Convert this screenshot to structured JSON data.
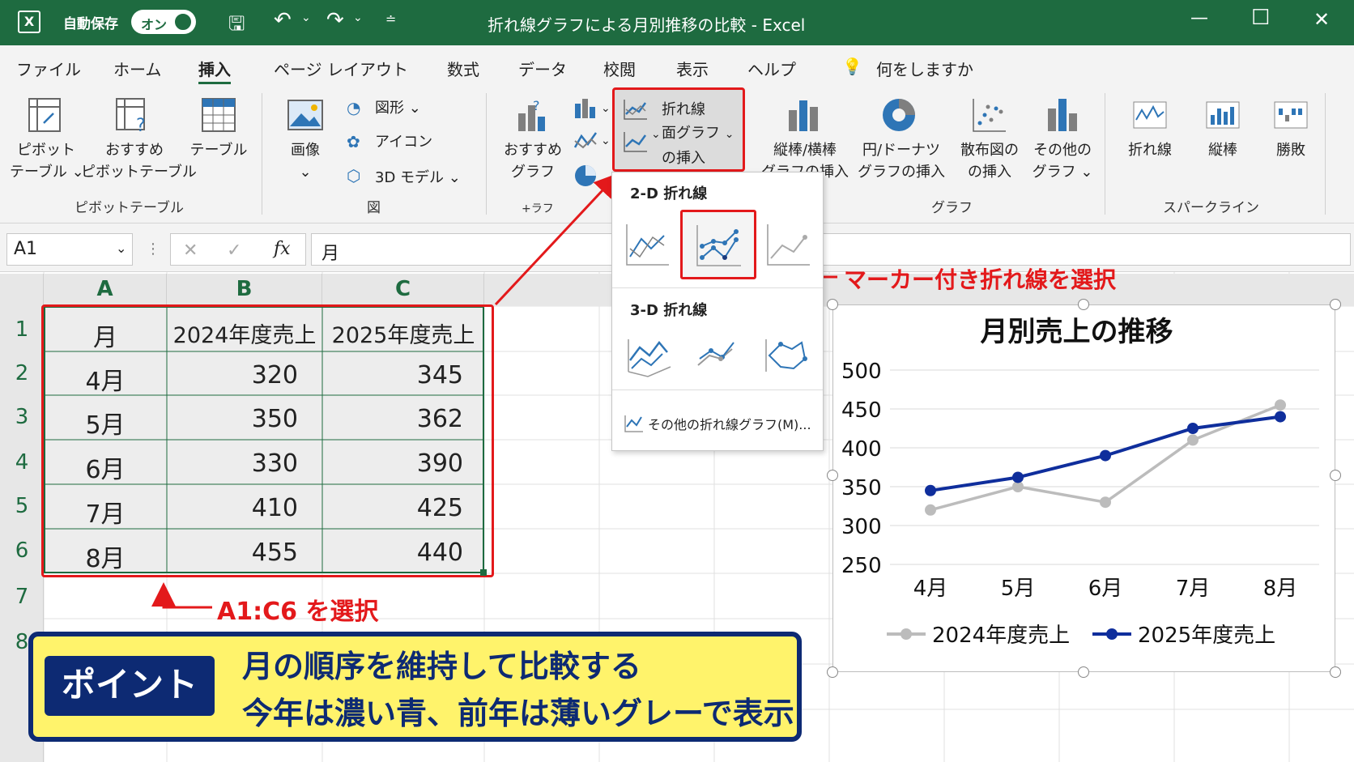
{
  "titlebar": {
    "autosave_label": "自動保存",
    "autosave_state": "オン",
    "window_title": "折れ線グラフによる月別推移の比較 - Excel"
  },
  "menu": {
    "tabs": [
      "ファイル",
      "ホーム",
      "挿入",
      "ページ レイアウト",
      "数式",
      "データ",
      "校閲",
      "表示",
      "ヘルプ"
    ],
    "active_tab": "挿入",
    "tell_me": "何をしますか"
  },
  "ribbon": {
    "pivot_table": [
      "ピボット",
      "テーブル ⌄"
    ],
    "recommended_pivot": [
      "おすすめ",
      "ピボットテーブル"
    ],
    "table": "テーブル",
    "group_pivot": "ピボットテーブル",
    "image": "画像",
    "shapes": "図形 ⌄",
    "icons": "アイコン",
    "model3d": "3D モデル ⌄",
    "group_illustrations": "図",
    "recommended_chart": [
      "おすすめ",
      "グラフ"
    ],
    "group_partial": "+ラフ",
    "line_area": [
      "折れ線",
      "面グラフ",
      "の挿入"
    ],
    "bar_column": [
      "縦棒/横棒",
      "グラフの挿入"
    ],
    "pie_donut": [
      "円/ドーナツ",
      "グラフの挿入"
    ],
    "scatter": [
      "散布図の",
      "の挿入"
    ],
    "other_chart": [
      "その他の",
      "グラフ ⌄"
    ],
    "group_charts": "グラフ",
    "spark_line": "折れ線",
    "spark_column": "縦棒",
    "spark_winloss": "勝敗",
    "group_sparklines": "スパークライン"
  },
  "formula_bar": {
    "name_box": "A1",
    "fx": "fx",
    "value": "月"
  },
  "sheet": {
    "columns": [
      "A",
      "B",
      "C"
    ],
    "rows": [
      "1",
      "2",
      "3",
      "4",
      "5",
      "6",
      "7",
      "8"
    ],
    "header": [
      "月",
      "2024年度売上",
      "2025年度売上"
    ],
    "data": [
      [
        "4月",
        "320",
        "345"
      ],
      [
        "5月",
        "350",
        "362"
      ],
      [
        "6月",
        "330",
        "390"
      ],
      [
        "7月",
        "410",
        "425"
      ],
      [
        "8月",
        "455",
        "440"
      ]
    ]
  },
  "dropdown": {
    "section_2d": "2-D 折れ線",
    "section_3d": "3-D 折れ線",
    "more": "その他の折れ線グラフ(M)..."
  },
  "annotations": {
    "marker_callout": "マーカー付き折れ線を選択",
    "range_callout": "A1:C6 を選択"
  },
  "chart_data": {
    "type": "line",
    "title": "月別売上の推移",
    "categories": [
      "4月",
      "5月",
      "6月",
      "7月",
      "8月"
    ],
    "series": [
      {
        "name": "2024年度売上",
        "values": [
          320,
          350,
          330,
          410,
          455
        ],
        "color": "#bcbcbc"
      },
      {
        "name": "2025年度売上",
        "values": [
          345,
          362,
          390,
          425,
          440
        ],
        "color": "#0f2e9c"
      }
    ],
    "yticks": [
      "500",
      "450",
      "400",
      "350",
      "300",
      "250"
    ],
    "ylim": [
      250,
      500
    ],
    "grid": true,
    "legend": "bottom"
  },
  "banner": {
    "badge": "ポイント",
    "line1": "月の順序を維持して比較する",
    "line2": "今年は濃い青、前年は薄いグレーで表示"
  },
  "colors": {
    "excel_green": "#1e6b40",
    "highlight_red": "#e3191b",
    "navy": "#0d2a73",
    "banner_yellow": "#fff36b"
  }
}
